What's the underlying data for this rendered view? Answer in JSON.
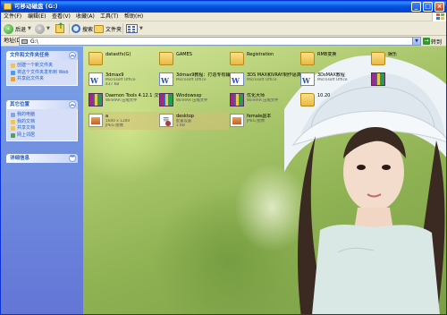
{
  "window": {
    "title": "可移动磁盘 (G:)",
    "controls": {
      "minimize": "_",
      "maximize": "□",
      "close": "×"
    }
  },
  "menubar": {
    "items": [
      "文件(F)",
      "编辑(E)",
      "查看(V)",
      "收藏(A)",
      "工具(T)",
      "帮助(H)"
    ]
  },
  "toolbar": {
    "back_label": "后退",
    "search_label": "搜索",
    "folders_label": "文件夹"
  },
  "address": {
    "label": "地址(D)",
    "value": "G:\\",
    "go_label": "转到"
  },
  "sidebar": {
    "panels": [
      {
        "title": "文件和文件夹任务",
        "links": [
          "创建一个新文件夹",
          "将这个文件夹发布到 Web",
          "共享此文件夹"
        ]
      },
      {
        "title": "其它位置",
        "links": [
          "我的电脑",
          "我的文档",
          "共享文档",
          "网上邻居"
        ]
      },
      {
        "title": "详细信息",
        "links": []
      }
    ]
  },
  "files": [
    {
      "name": "datastfx(G)",
      "sub1": "",
      "sub2": "",
      "type": "folder"
    },
    {
      "name": "GAMES",
      "sub1": "",
      "sub2": "",
      "type": "folder"
    },
    {
      "name": "Registration",
      "sub1": "",
      "sub2": "",
      "type": "folder"
    },
    {
      "name": "RMB变换",
      "sub1": "",
      "sub2": "",
      "type": "folder"
    },
    {
      "name": "娱乐",
      "sub1": "",
      "sub2": "",
      "type": "folder"
    },
    {
      "name": "3dmax9",
      "sub1": "Microsoft Office",
      "sub2": "437 KB",
      "type": "word"
    },
    {
      "name": "3dmax9教程：打造专有辅助高动效果",
      "sub1": "Microsoft Office",
      "sub2": "",
      "type": "word"
    },
    {
      "name": "3DS MAX和VRAY制作逼真草莓的乡村油画大人",
      "sub1": "Microsoft Office",
      "sub2": "",
      "type": "word"
    },
    {
      "name": "3DsMAX教程",
      "sub1": "Microsoft Office",
      "sub2": "",
      "type": "word"
    },
    {
      "name": "",
      "sub1": "",
      "sub2": "",
      "type": "rar"
    },
    {
      "name": "Daemon Tools 4.12.1 汉化版",
      "sub1": "WinRAR 压缩文件",
      "sub2": "",
      "type": "rar"
    },
    {
      "name": "Windowsxp",
      "sub1": "WinRAR 压缩文件",
      "sub2": "",
      "type": "rar"
    },
    {
      "name": "优化大师",
      "sub1": "WinRAR 压缩文件",
      "sub2": "",
      "type": "rar"
    },
    {
      "name": "10.20",
      "sub1": "",
      "sub2": "",
      "type": "folder"
    },
    {
      "name": "a",
      "sub1": "1600 x 1200",
      "sub2": "JPEG 图像",
      "type": "jpg"
    },
    {
      "name": "desktop",
      "sub1": "配置设置",
      "sub2": "1 KB",
      "type": "cfg"
    },
    {
      "name": "female副本",
      "sub1": "",
      "sub2": "JPEG 图像",
      "type": "jpg"
    }
  ]
}
